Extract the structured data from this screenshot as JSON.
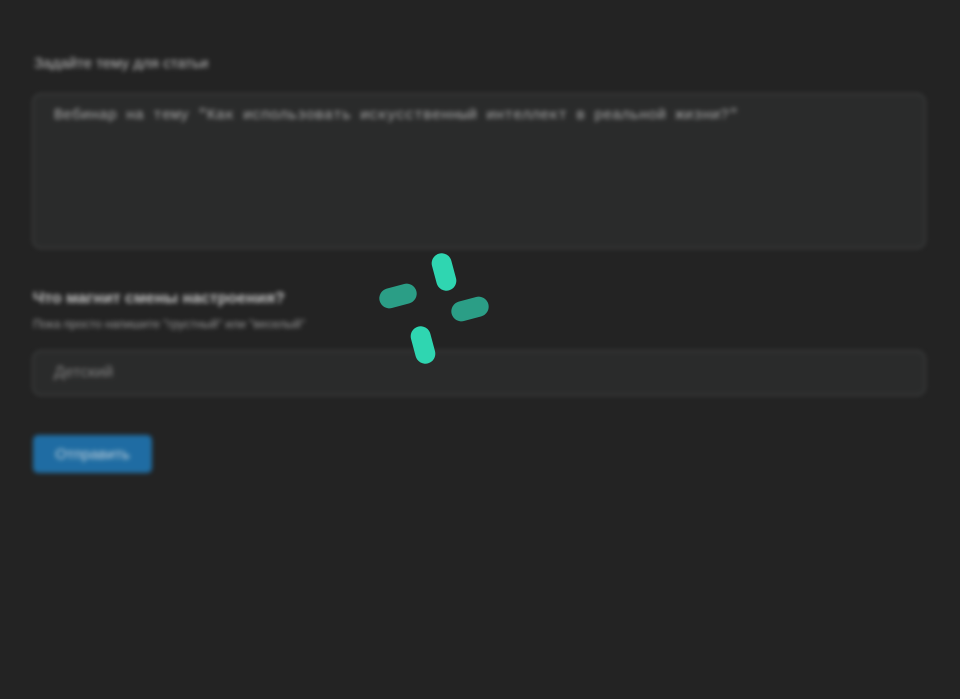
{
  "form": {
    "topic_label": "Задайте тему для статьи",
    "topic_value": "Вебинар на тему \"Как использовать искусственный интеллект в реальной жизни?\"",
    "mood_label": "Что магнит смены настроения?",
    "mood_hint": "Пока просто напишите \"грустный\" или \"веселый\"",
    "mood_value": "Детский",
    "submit_label": "Отправить"
  },
  "spinner": {
    "icon": "loading-spinner-icon",
    "colors": {
      "bright": "#2fd6b1",
      "dim": "#2b9e86"
    }
  },
  "colors": {
    "background": "#232323",
    "field_background": "#2b2c2c",
    "field_border": "#3c3d3d",
    "accent": "#1f75b1"
  }
}
